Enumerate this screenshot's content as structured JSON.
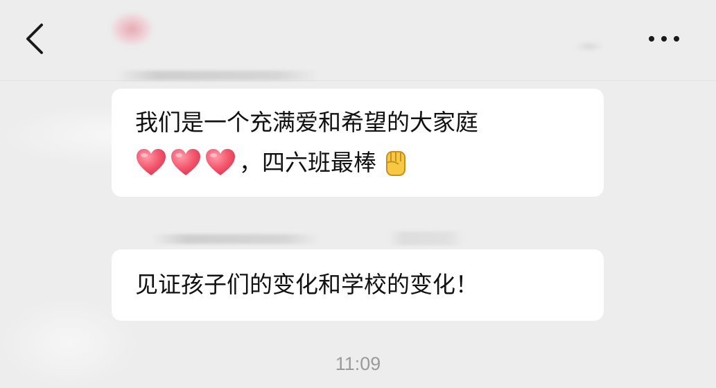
{
  "header": {
    "back_icon": "chevron-left-icon",
    "more_icon": "more-horizontal-icon"
  },
  "messages": [
    {
      "line1": "我们是一个充满爱和希望的大家庭",
      "line2_text": "，四六班最棒",
      "emojis": [
        "red-heart-icon",
        "red-heart-icon",
        "red-heart-icon",
        "raised-fist-icon"
      ]
    },
    {
      "line1": "见证孩子们的变化和学校的变化！"
    }
  ],
  "timestamp": "11:09",
  "colors": {
    "background": "#ededed",
    "bubble": "#ffffff",
    "text": "#111111",
    "timestamp": "#9a9a9a"
  }
}
